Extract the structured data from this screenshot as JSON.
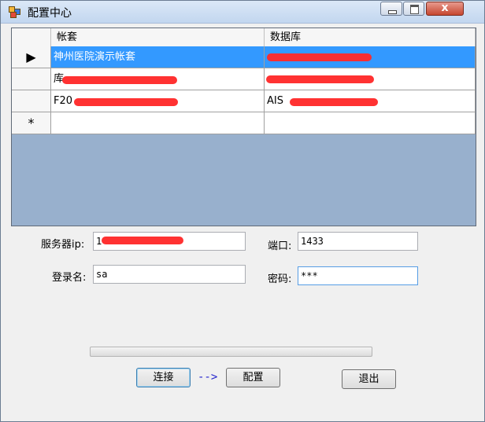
{
  "window": {
    "title": "配置中心",
    "controls": {
      "minimize": "",
      "maximize": "",
      "close": "x"
    }
  },
  "grid": {
    "columns": [
      "帐套",
      "数据库"
    ],
    "rows": [
      {
        "marker": "▶",
        "account": "神州医院演示帐套",
        "database": "",
        "selected": true
      },
      {
        "marker": "",
        "account": "库",
        "database": "",
        "selected": false
      },
      {
        "marker": "",
        "account": "F20",
        "database": "AIS",
        "selected": false
      },
      {
        "marker": "*",
        "account": "",
        "database": "",
        "selected": false
      }
    ]
  },
  "form": {
    "server_ip_label": "服务器ip:",
    "server_ip_value": "1",
    "port_label": "端口:",
    "port_value": "1433",
    "login_label": "登录名:",
    "login_value": "sa",
    "password_label": "密码:",
    "password_value": "***"
  },
  "progress": {
    "value": 0
  },
  "buttons": {
    "connect": "连接",
    "arrow": "-->",
    "configure": "配置",
    "exit": "退出"
  },
  "colors": {
    "selection": "#3399ff",
    "grid_background": "#98b0cd",
    "redaction": "#ff2a2a"
  }
}
